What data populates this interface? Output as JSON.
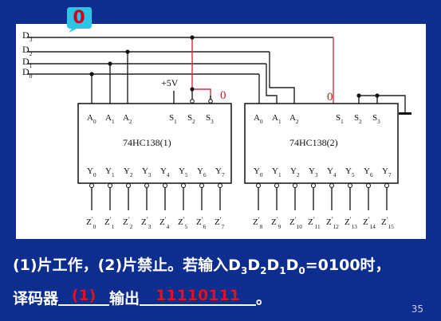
{
  "bubble_value": "0",
  "inputs": {
    "d3": "D",
    "d2": "D",
    "d1": "D",
    "d0": "D"
  },
  "inputs_sub": {
    "d3": "3",
    "d2": "2",
    "d1": "1",
    "d0": "0"
  },
  "vcc_label": "+5V",
  "chip1": {
    "name": "74HC138(1)",
    "inputs": [
      "A",
      "A",
      "A",
      "S",
      "S",
      "S"
    ],
    "input_subs": [
      "0",
      "1",
      "2",
      "1",
      "2",
      "3"
    ],
    "outputs": [
      "Y",
      "Y",
      "Y",
      "Y",
      "Y",
      "Y",
      "Y",
      "Y"
    ],
    "output_subs": [
      "0",
      "1",
      "2",
      "3",
      "4",
      "5",
      "6",
      "7"
    ],
    "out_labels": [
      "Z",
      "Z",
      "Z",
      "Z",
      "Z",
      "Z",
      "Z",
      "Z"
    ],
    "out_subs": [
      "0",
      "1",
      "2",
      "3",
      "4",
      "5",
      "6",
      "7"
    ]
  },
  "chip2": {
    "name": "74HC138(2)",
    "inputs": [
      "A",
      "A",
      "A",
      "S",
      "S",
      "S"
    ],
    "input_subs": [
      "0",
      "1",
      "2",
      "1",
      "2",
      "3"
    ],
    "outputs": [
      "Y",
      "Y",
      "Y",
      "Y",
      "Y",
      "Y",
      "Y",
      "Y"
    ],
    "output_subs": [
      "0",
      "1",
      "2",
      "3",
      "4",
      "5",
      "6",
      "7"
    ],
    "out_labels": [
      "Z",
      "Z",
      "Z",
      "Z",
      "Z",
      "Z",
      "Z",
      "Z"
    ],
    "out_subs": [
      "8",
      "9",
      "10",
      "11",
      "12",
      "13",
      "14",
      "15"
    ]
  },
  "annot_s2s3_chip1": "0",
  "annot_s1_chip2": "0",
  "caption": {
    "line1_a": "(1)片工作，(2)片禁止。若输入D",
    "line1_sub3": "3",
    "line1_d2": "D",
    "line1_sub2": "2",
    "line1_d1": "D",
    "line1_sub1": "1",
    "line1_d0": "D",
    "line1_sub0": "0",
    "line1_b": "=0100时，",
    "line2_a": "译码器",
    "line2_blank1": "(1)",
    "line2_b": "输出",
    "line2_blank2": "11110111",
    "line2_c": "。"
  },
  "page_number": "35",
  "colors": {
    "bg": "#0d2d8f",
    "wire": "#222222",
    "red": "#e0101e",
    "bubble": "#29c6e6"
  }
}
